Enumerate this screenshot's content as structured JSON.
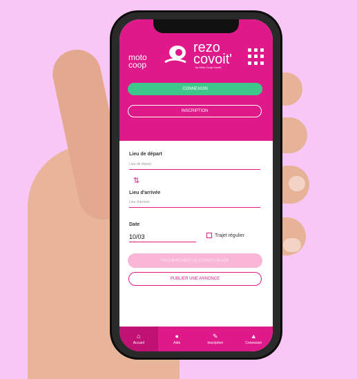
{
  "brand": {
    "moto_coop": "moto coop",
    "rezo": "rezo",
    "covoit": "covoit'",
    "tagline": "by Moto Coop Covoit"
  },
  "header": {
    "connexion_label": "CONNEXION",
    "inscription_label": "INSCRIPTION"
  },
  "form": {
    "depart_label": "Lieu de départ",
    "depart_placeholder": "Lieu de départ",
    "arrivee_label": "Lieu d'arrivée",
    "arrivee_placeholder": "Lieu d'arrivée",
    "date_label": "Date",
    "date_value": "10/03",
    "regular_label": "Trajet régulier",
    "search_label": "RECHERCHER UN COVOITURAGE",
    "publish_label": "PUBLIER UNE ANNONCE"
  },
  "nav": {
    "items": [
      {
        "label": "Accueil",
        "icon": "home-icon"
      },
      {
        "label": "Aide",
        "icon": "help-icon"
      },
      {
        "label": "Inscription",
        "icon": "pencil-icon"
      },
      {
        "label": "Connexion",
        "icon": "user-icon"
      }
    ]
  },
  "colors": {
    "brand_pink": "#e0198a",
    "green": "#3fc789",
    "background": "#f9c7f6"
  }
}
